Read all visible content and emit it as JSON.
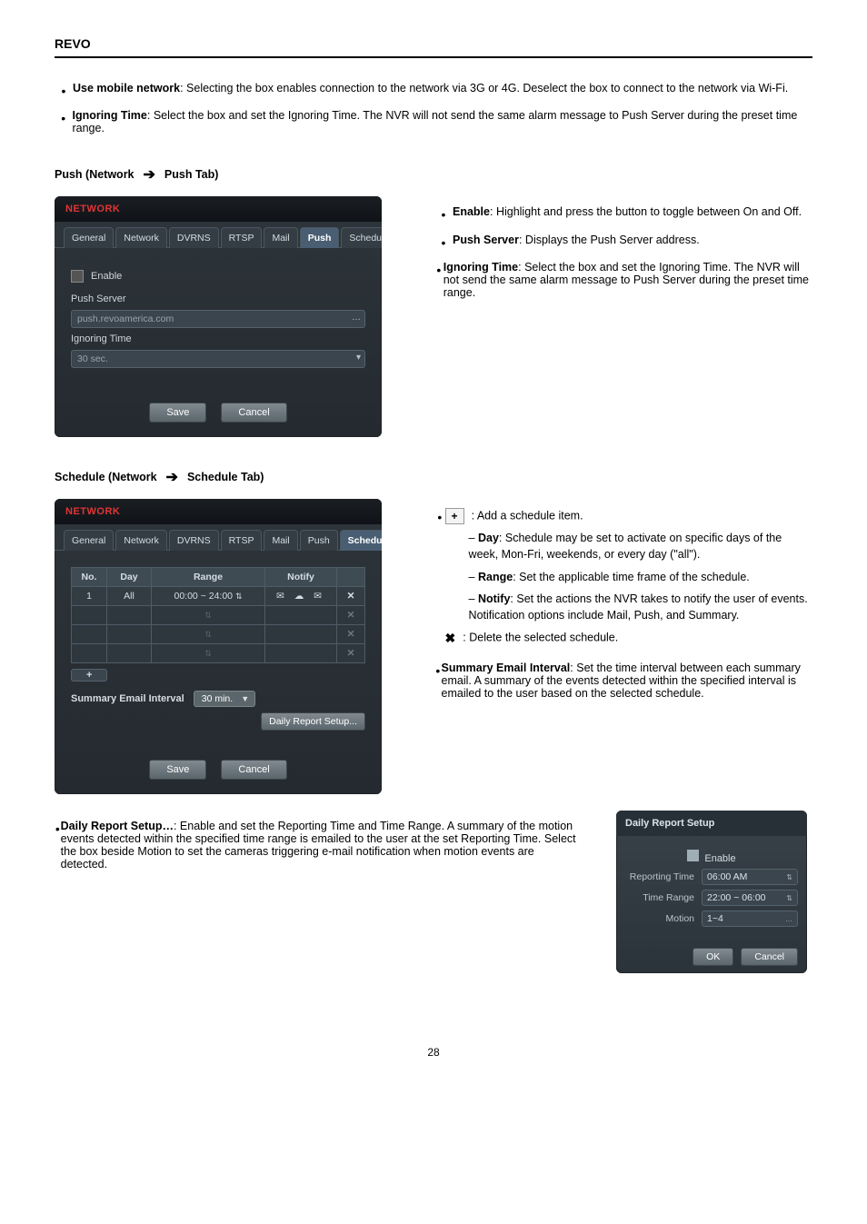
{
  "header": {
    "brand": "REVO"
  },
  "intro_bullets": [
    {
      "lead": "Use mobile network",
      "text": ": Selecting the box enables connection to the network via 3G or 4G. Deselect the box to connect to the network via Wi-Fi."
    },
    {
      "lead": "Ignoring Time",
      "text": ": Select the box and set the Ignoring Time. The NVR will not send the same alarm message to Push Server during the preset time range."
    }
  ],
  "breadcrumb_push": {
    "seg1": "Push (Network",
    "seg2": "Push Tab)"
  },
  "push_dialog": {
    "title": "NETWORK",
    "tabs": [
      "General",
      "Network",
      "DVRNS",
      "RTSP",
      "Mail",
      "Push",
      "Schedule"
    ],
    "active_tab": 5,
    "enable_label": "Enable",
    "server_label": "Push Server",
    "server_value": "push.revoamerica.com",
    "ignore_label": "Ignoring Time",
    "ignore_value": "30 sec.",
    "save": "Save",
    "cancel": "Cancel"
  },
  "push_side_bullets": [
    {
      "lead": "Enable",
      "text": ": Highlight and press the button to toggle between On and Off."
    },
    {
      "lead": "Push Server",
      "text": ": Displays the Push Server address."
    },
    {
      "lead": "Ignoring Time",
      "text": ": Select the box and set the Ignoring Time. The NVR will not send the same alarm message to Push Server during the preset time range."
    }
  ],
  "breadcrumb_sched": {
    "seg1": "Schedule (Network",
    "seg2": "Schedule Tab)"
  },
  "sched_dialog": {
    "title": "NETWORK",
    "tabs": [
      "General",
      "Network",
      "DVRNS",
      "RTSP",
      "Mail",
      "Push",
      "Schedule"
    ],
    "active_tab": 6,
    "columns": [
      "No.",
      "Day",
      "Range",
      "Notify",
      ""
    ],
    "rows": [
      {
        "no": "1",
        "day": "All",
        "range": "00:00 ~ 24:00",
        "notify_icons": "✉ ☁ ✉",
        "x": "✕"
      },
      {
        "no": "",
        "day": "",
        "range": "",
        "notify_icons": "",
        "x": "✕",
        "muted": true
      },
      {
        "no": "",
        "day": "",
        "range": "",
        "notify_icons": "",
        "x": "✕",
        "muted": true
      },
      {
        "no": "",
        "day": "",
        "range": "",
        "notify_icons": "",
        "x": "✕",
        "muted": true
      }
    ],
    "add_label": "+",
    "summary_label": "Summary Email Interval",
    "summary_value": "30 min.",
    "daily_btn": "Daily Report Setup...",
    "save": "Save",
    "cancel": "Cancel"
  },
  "sched_side": {
    "lead_text": ": Add a schedule item.",
    "sub_day": {
      "lead": "Day",
      "text": ": Schedule may be set to activate on specific days of the week, Mon-Fri, weekends, or every day (\"all\")."
    },
    "sub_range": {
      "lead": "Range",
      "text": ": Set the applicable time frame of the schedule."
    },
    "sub_notify": {
      "lead": "Notify",
      "text": ": Set the actions the NVR takes to notify the user of events. Notification options include Mail, Push, and Summary."
    },
    "x_text": ": Delete the selected schedule.",
    "summary": {
      "lead": "Summary Email Interval",
      "text": ": Set the time interval between each summary email. A summary of the events detected within the specified interval is emailed to the user based on the selected schedule."
    }
  },
  "daily_report_text": {
    "lead": "Daily Report Setup…",
    "text": ": Enable and set the Reporting Time and Time Range. A summary of the motion events detected within the specified time range is emailed to the user at the set Reporting Time. Select the box beside Motion to set the cameras triggering e-mail notification when motion events are detected."
  },
  "daily_dialog": {
    "title": "Daily Report Setup",
    "enable_label": "Enable",
    "rt_label": "Reporting Time",
    "rt_value": "06:00 AM",
    "tr_label": "Time Range",
    "tr_value": "22:00 ~ 06:00",
    "mo_label": "Motion",
    "mo_value": "1~4",
    "ok": "OK",
    "cancel": "Cancel"
  },
  "page_number": "28"
}
